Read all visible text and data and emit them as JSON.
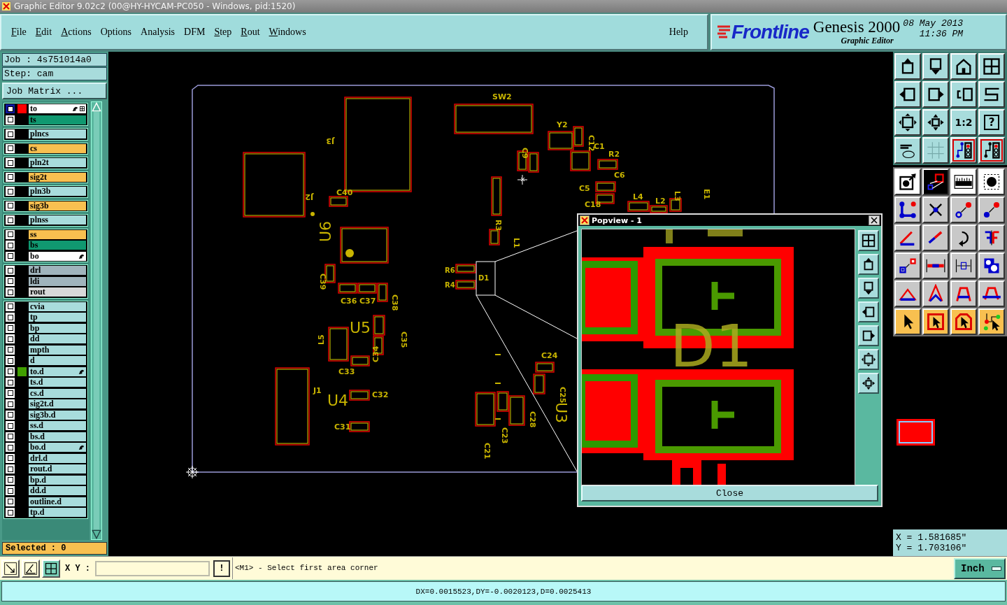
{
  "window": {
    "title": "Graphic Editor 9.02c2 (00@HY-HYCAM-PC050 - Windows, pid:1520)"
  },
  "menu": [
    {
      "label": "File",
      "underlined": true
    },
    {
      "label": "Edit",
      "underlined": true
    },
    {
      "label": "Actions",
      "underlined": true
    },
    {
      "label": "Options",
      "underlined": false
    },
    {
      "label": "Analysis",
      "underlined": false
    },
    {
      "label": "DFM",
      "underlined": false
    },
    {
      "label": "Step",
      "underlined": true
    },
    {
      "label": "Rout",
      "underlined": true
    },
    {
      "label": "Windows",
      "underlined": true
    }
  ],
  "help": "Help",
  "brand": {
    "logo": "Frontline",
    "product": "Genesis 2000",
    "subtitle": "Graphic Editor",
    "date": "08 May 2013",
    "time": "11:36 PM"
  },
  "job": {
    "job": "Job : 4s751014a0",
    "step": "Step: cam",
    "matrix_button": "Job Matrix ..."
  },
  "layer_groups": [
    [
      {
        "name": "to",
        "kind": "silk",
        "color": "#ff0000",
        "affected": true,
        "selected": true
      },
      {
        "name": "ts",
        "kind": "mask",
        "affected": false,
        "selected": false
      }
    ],
    [
      {
        "name": "plncs",
        "kind": "power",
        "affected": false,
        "selected": false
      }
    ],
    [
      {
        "name": "cs",
        "kind": "signal",
        "affected": false,
        "selected": false
      }
    ],
    [
      {
        "name": "pln2t",
        "kind": "power",
        "affected": false,
        "selected": false
      }
    ],
    [
      {
        "name": "sig2t",
        "kind": "signal",
        "affected": false,
        "selected": false
      }
    ],
    [
      {
        "name": "pln3b",
        "kind": "power",
        "affected": false,
        "selected": false
      }
    ],
    [
      {
        "name": "sig3b",
        "kind": "signal",
        "affected": false,
        "selected": false
      }
    ],
    [
      {
        "name": "plnss",
        "kind": "power",
        "affected": false,
        "selected": false
      }
    ],
    [
      {
        "name": "ss",
        "kind": "signal",
        "affected": false,
        "selected": false
      },
      {
        "name": "bs",
        "kind": "mask",
        "affected": false,
        "selected": false
      },
      {
        "name": "bo",
        "kind": "silk",
        "affected": true,
        "selected": false
      }
    ],
    [
      {
        "name": "drl",
        "kind": "drill",
        "affected": false,
        "selected": false
      },
      {
        "name": "ldi",
        "kind": "drill",
        "affected": false,
        "selected": false
      },
      {
        "name": "rout",
        "kind": "rout",
        "affected": false,
        "selected": false
      }
    ],
    [
      {
        "name": "cvia",
        "kind": "document",
        "affected": false,
        "selected": false
      },
      {
        "name": "tp",
        "kind": "document",
        "affected": false,
        "selected": false
      },
      {
        "name": "bp",
        "kind": "document",
        "affected": false,
        "selected": false
      },
      {
        "name": "dd",
        "kind": "document",
        "affected": false,
        "selected": false
      },
      {
        "name": "mpth",
        "kind": "document",
        "affected": false,
        "selected": false
      },
      {
        "name": "d",
        "kind": "document",
        "affected": false,
        "selected": false
      },
      {
        "name": "to.d",
        "kind": "document",
        "color": "#40a000",
        "affected": true,
        "selected": false
      },
      {
        "name": "ts.d",
        "kind": "document",
        "affected": false,
        "selected": false
      },
      {
        "name": "cs.d",
        "kind": "document",
        "affected": false,
        "selected": false
      },
      {
        "name": "sig2t.d",
        "kind": "document",
        "affected": false,
        "selected": false
      },
      {
        "name": "sig3b.d",
        "kind": "document",
        "affected": false,
        "selected": false
      },
      {
        "name": "ss.d",
        "kind": "document",
        "affected": false,
        "selected": false
      },
      {
        "name": "bs.d",
        "kind": "document",
        "affected": false,
        "selected": false
      },
      {
        "name": "bo.d",
        "kind": "document",
        "affected": true,
        "selected": false
      },
      {
        "name": "drl.d",
        "kind": "document",
        "affected": false,
        "selected": false
      },
      {
        "name": "rout.d",
        "kind": "document",
        "affected": false,
        "selected": false
      },
      {
        "name": "bp.d",
        "kind": "document",
        "affected": false,
        "selected": false
      },
      {
        "name": "dd.d",
        "kind": "document",
        "affected": false,
        "selected": false
      },
      {
        "name": "outline.d",
        "kind": "document",
        "affected": false,
        "selected": false
      },
      {
        "name": "tp.d",
        "kind": "document",
        "affected": false,
        "selected": false
      }
    ]
  ],
  "selected_count": "Selected : 0",
  "pcb": {
    "labels": [
      "SW2",
      "J3",
      "J2",
      "C40",
      "U6",
      "C39",
      "C36",
      "C37",
      "C38",
      "U5",
      "L5",
      "C33",
      "C34",
      "C35",
      "J1",
      "U4",
      "C32",
      "C31",
      "R6",
      "R4",
      "D1",
      "C24",
      "C25",
      "C28",
      "C23",
      "C21",
      "U3",
      "Y2",
      "C12",
      "C1",
      "R2",
      "C6",
      "C5",
      "C18",
      "L4",
      "L2",
      "L3",
      "E1",
      "R3",
      "L1",
      "C9"
    ]
  },
  "popview": {
    "title": "Popview - 1",
    "label": "D1",
    "close_button": "Close"
  },
  "toolbar_labels": {
    "scale": "1:2",
    "help": "?"
  },
  "coordinates": {
    "x": "X = 1.581685\"",
    "y": "Y = 1.703106\""
  },
  "command": {
    "xy_label": "X Y :",
    "alert_button": "!",
    "prompt": "<M1> - Select first area corner",
    "unit": "Inch"
  },
  "status": "DX=0.0015523,DY=-0.0020123,D=0.0025413"
}
